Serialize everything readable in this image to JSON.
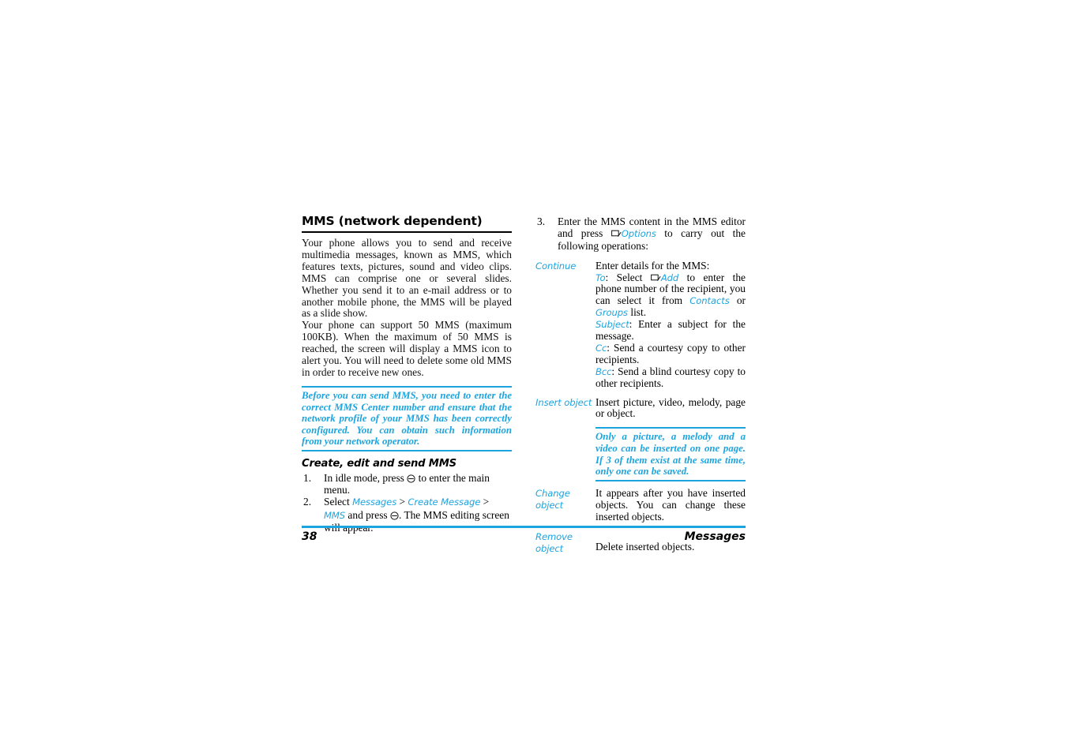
{
  "page": {
    "number": "38",
    "section": "Messages",
    "accent_color": "#1CA4DF",
    "text_color": "#000000",
    "background": "#FFFFFF"
  },
  "left_column": {
    "heading": "MMS (network dependent)",
    "paragraph_1": "Your phone allows you to send and receive multimedia messages, known as MMS, which features texts, pictures, sound and video clips. MMS can comprise one or several slides. Whether you send it to an e-mail address or to another mobile phone, the MMS will be played as a slide show.",
    "paragraph_2": "Your phone can support 50 MMS (maximum 100KB). When the maximum of 50 MMS is reached, the screen will display a MMS icon to alert you. You will need to delete some old MMS in order to receive new ones.",
    "note": "Before you can send MMS, you need to enter the correct MMS Center number and ensure that the network profile of your MMS has been correctly configured. You can obtain such information from your network operator.",
    "subheading": "Create, edit and send MMS",
    "steps": [
      {
        "number": "1.",
        "prefix": "In idle mode, press ",
        "icon": "navigation-key-icon",
        "suffix": " to enter the main menu."
      },
      {
        "number": "2.",
        "prefix": "Select ",
        "menu_1": "Messages",
        "sep_1": " > ",
        "menu_2": "Create Message",
        "sep_2": " > ",
        "menu_3": "MMS",
        "mid": " and press ",
        "icon": "navigation-key-icon",
        "suffix": ". The MMS editing screen will appear."
      }
    ]
  },
  "right_column": {
    "step_3": {
      "number": "3.",
      "part_1": "Enter the MMS content in the MMS editor and press ",
      "icon": "softkey-icon",
      "link": "Options",
      "part_2": " to carry out the following operations:"
    },
    "options": [
      {
        "label": "Continue",
        "lines": [
          {
            "text": "Enter details for the MMS:"
          }
        ],
        "to_line": {
          "key": "To",
          "pre": ": Select ",
          "icon": "softkey-icon",
          "link": "Add",
          "post": " to enter the phone number of the recipient, you can select it from ",
          "link2": "Contacts",
          "mid": " or ",
          "link3": "Groups",
          "end": " list."
        },
        "subject_line": {
          "key": "Subject",
          "text": ": Enter a subject for the message."
        },
        "cc_line": {
          "key": "Cc",
          "text": ": Send a courtesy copy to other recipients."
        },
        "bcc_line": {
          "key": "Bcc",
          "text": ": Send a blind courtesy copy to other recipients."
        }
      },
      {
        "label": "Insert object",
        "description": "Insert picture, video, melody, page or object.",
        "note": "Only a picture, a melody and a video can be inserted on one page. If 3 of them exist at the same time, only one can be saved."
      },
      {
        "label": "Change object",
        "description": "It appears after you have inserted objects. You can change these inserted objects."
      },
      {
        "label": "Remove object",
        "description": "Delete inserted objects."
      }
    ]
  }
}
